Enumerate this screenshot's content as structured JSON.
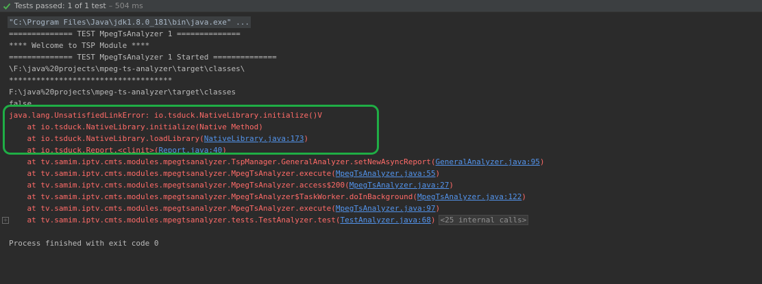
{
  "status": {
    "label": "Tests passed:",
    "count": "1 of 1 test",
    "duration": "– 504 ms",
    "accent": "#4caf50"
  },
  "console": {
    "command": "\"C:\\Program Files\\Java\\jdk1.8.0_181\\bin\\java.exe\" ...",
    "out1": "============== TEST MpegTsAnalyzer 1 ==============",
    "out2": "**** Welcome to TSP Module ****",
    "out3": "============== TEST MpegTsAnalyzer 1 Started ==============",
    "out4": "\\F:\\java%20projects\\mpeg-ts-analyzer\\target\\classes\\",
    "out5": "************************************",
    "out6": "F:\\java%20projects\\mpeg-ts-analyzer\\target\\classes",
    "out7": "false",
    "error": "java.lang.UnsatisfiedLinkError: io.tsduck.NativeLibrary.initialize()V",
    "frames": [
      {
        "prefix": "    at io.tsduck.NativeLibrary.initialize(Native Method)",
        "link": "",
        "suffix": ""
      },
      {
        "prefix": "    at io.tsduck.NativeLibrary.loadLibrary(",
        "link": "NativeLibrary.java:173",
        "suffix": ")"
      },
      {
        "prefix": "    at io.tsduck.Report.<clinit>(",
        "link": "Report.java:40",
        "suffix": ")"
      },
      {
        "prefix": "    at tv.samim.iptv.cmts.modules.mpegtsanalyzer.TspManager.GeneralAnalyzer.setNewAsyncReport(",
        "link": "GeneralAnalyzer.java:95",
        "suffix": ")"
      },
      {
        "prefix": "    at tv.samim.iptv.cmts.modules.mpegtsanalyzer.MpegTsAnalyzer.execute(",
        "link": "MpegTsAnalyzer.java:55",
        "suffix": ")"
      },
      {
        "prefix": "    at tv.samim.iptv.cmts.modules.mpegtsanalyzer.MpegTsAnalyzer.access$200(",
        "link": "MpegTsAnalyzer.java:27",
        "suffix": ")"
      },
      {
        "prefix": "    at tv.samim.iptv.cmts.modules.mpegtsanalyzer.MpegTsAnalyzer$TaskWorker.doInBackground(",
        "link": "MpegTsAnalyzer.java:122",
        "suffix": ")"
      },
      {
        "prefix": "    at tv.samim.iptv.cmts.modules.mpegtsanalyzer.MpegTsAnalyzer.execute(",
        "link": "MpegTsAnalyzer.java:97",
        "suffix": ")"
      },
      {
        "prefix": "    at tv.samim.iptv.cmts.modules.mpegtsanalyzer.tests.TestAnalyzer.test(",
        "link": "TestAnalyzer.java:68",
        "suffix": ")"
      }
    ],
    "internal_calls": "<25 internal calls>",
    "exit": "Process finished with exit code 0"
  }
}
